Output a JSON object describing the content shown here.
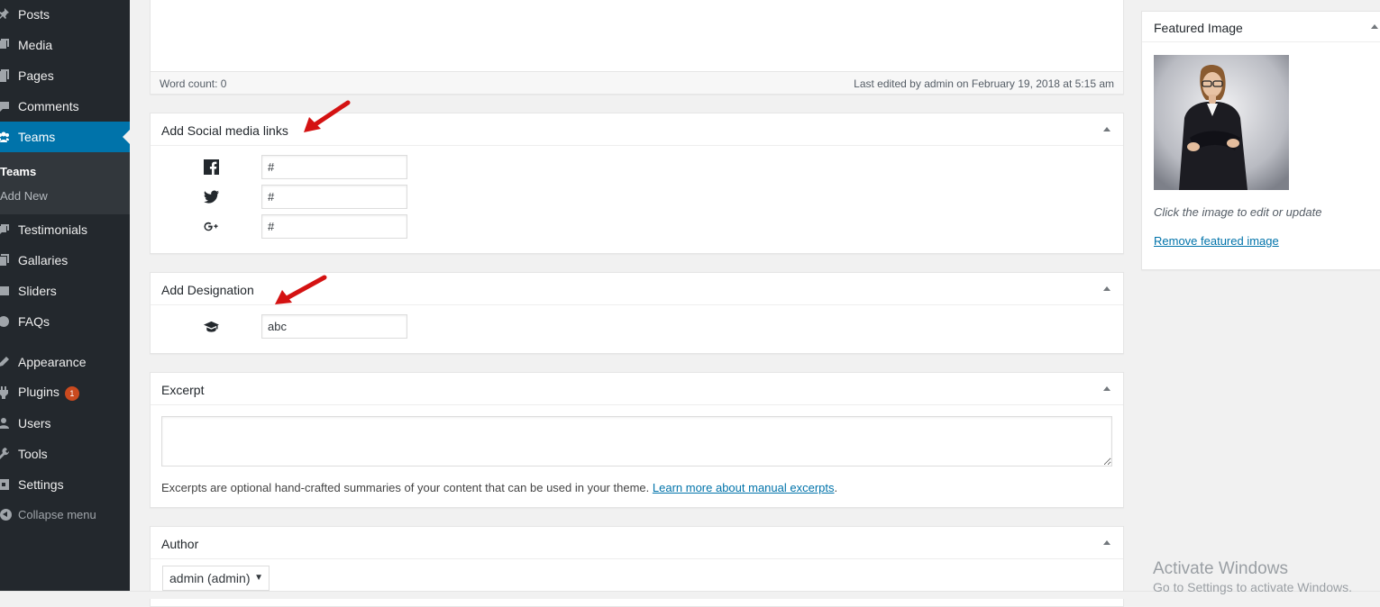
{
  "sidebar": {
    "items": [
      {
        "label": "Posts",
        "icon": "pin-icon"
      },
      {
        "label": "Media",
        "icon": "media-icon"
      },
      {
        "label": "Pages",
        "icon": "pages-icon"
      },
      {
        "label": "Comments",
        "icon": "comments-icon"
      },
      {
        "label": "Teams",
        "icon": "groups-icon"
      },
      {
        "label": "Testimonials",
        "icon": "testimonial-icon"
      },
      {
        "label": "Gallaries",
        "icon": "gallery-icon"
      },
      {
        "label": "Sliders",
        "icon": "slides-icon"
      },
      {
        "label": "FAQs",
        "icon": "faq-icon"
      },
      {
        "label": "Appearance",
        "icon": "appearance-icon"
      },
      {
        "label": "Plugins",
        "icon": "plugins-icon",
        "badge": "1"
      },
      {
        "label": "Users",
        "icon": "users-icon"
      },
      {
        "label": "Tools",
        "icon": "tools-icon"
      },
      {
        "label": "Settings",
        "icon": "settings-icon"
      }
    ],
    "submenu": [
      "Teams",
      "Add New"
    ],
    "collapse_label": "Collapse menu",
    "active_color": "#0073aa"
  },
  "editor": {
    "word_count": "Word count: 0",
    "last_edited": "Last edited by admin on February 19, 2018 at 5:15 am"
  },
  "social": {
    "title": "Add Social media links",
    "fields": [
      {
        "icon": "facebook-icon",
        "value": "#"
      },
      {
        "icon": "twitter-icon",
        "value": "#"
      },
      {
        "icon": "google-plus-icon",
        "value": "#"
      }
    ]
  },
  "designation": {
    "title": "Add Designation",
    "icon": "graduation-cap-icon",
    "value": "abc"
  },
  "excerpt": {
    "title": "Excerpt",
    "help": "Excerpts are optional hand-crafted summaries of your content that can be used in your theme.",
    "link": "Learn more about manual excerpts",
    "suffix": "."
  },
  "author": {
    "title": "Author",
    "selected": "admin (admin)"
  },
  "featured": {
    "title": "Featured Image",
    "caption": "Click the image to edit or update",
    "remove": "Remove featured image"
  },
  "watermark": {
    "title": "Activate Windows",
    "subtitle": "Go to Settings to activate Windows."
  }
}
